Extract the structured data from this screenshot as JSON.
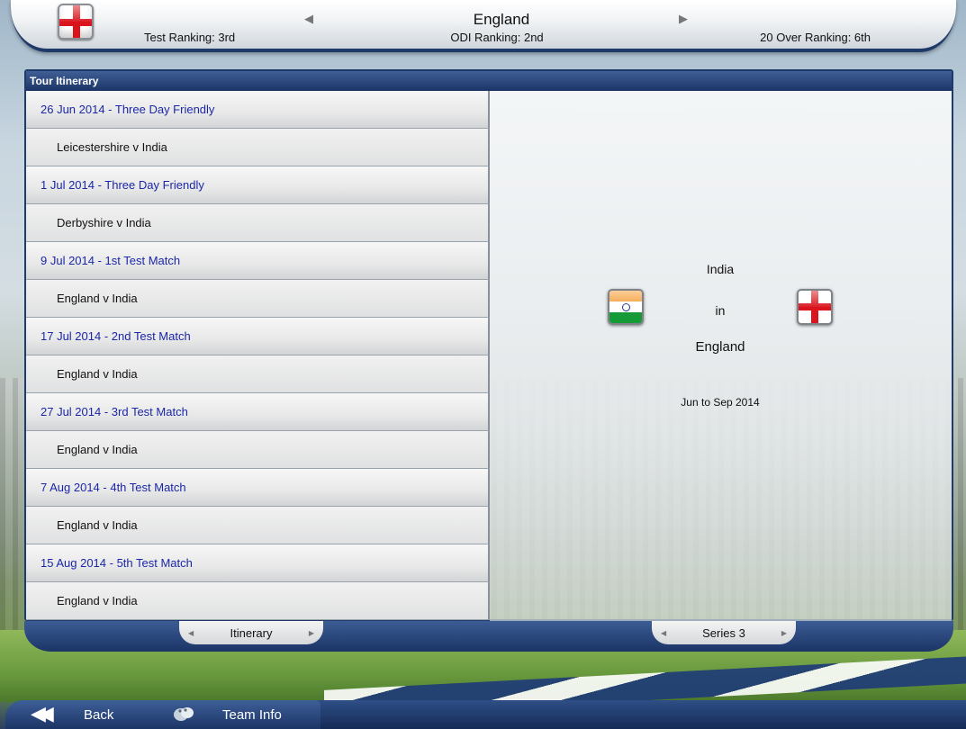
{
  "header": {
    "team_name": "England",
    "test_ranking": "Test Ranking: 3rd",
    "odi_ranking": "ODI Ranking: 2nd",
    "t20_ranking": "20 Over Ranking: 6th",
    "prev_arrow": "◀",
    "next_arrow": "▶"
  },
  "panel": {
    "title": "Tour Itinerary",
    "items": [
      {
        "label": "26 Jun 2014 - Three Day Friendly",
        "kind": "date"
      },
      {
        "label": "Leicestershire v India",
        "kind": "match"
      },
      {
        "label": "1 Jul 2014 - Three Day Friendly",
        "kind": "date"
      },
      {
        "label": "Derbyshire v India",
        "kind": "match"
      },
      {
        "label": "9 Jul 2014 - 1st Test Match",
        "kind": "date"
      },
      {
        "label": "England v India",
        "kind": "match"
      },
      {
        "label": "17 Jul 2014 - 2nd Test Match",
        "kind": "date"
      },
      {
        "label": "England v India",
        "kind": "match"
      },
      {
        "label": "27 Jul 2014 - 3rd Test Match",
        "kind": "date"
      },
      {
        "label": "England v India",
        "kind": "match"
      },
      {
        "label": "7 Aug 2014 - 4th Test Match",
        "kind": "date"
      },
      {
        "label": "England v India",
        "kind": "match"
      },
      {
        "label": "15 Aug 2014 - 5th Test Match",
        "kind": "date"
      },
      {
        "label": "England v India",
        "kind": "match"
      }
    ]
  },
  "detail": {
    "touring_team": "India",
    "connector": "in",
    "host_team": "England",
    "dates": "Jun to Sep 2014"
  },
  "tabs": {
    "itinerary": "Itinerary",
    "series": "Series 3",
    "arrow_left": "◀",
    "arrow_right": "▶"
  },
  "nav": {
    "back": "Back",
    "team_info": "Team Info",
    "back_icon": "◀◀"
  },
  "colors": {
    "date_text": "#1b27a8",
    "navy": "#1c3466",
    "england_red": "#d9141c",
    "india_saffron": "#f59b32",
    "india_green": "#169a38"
  }
}
